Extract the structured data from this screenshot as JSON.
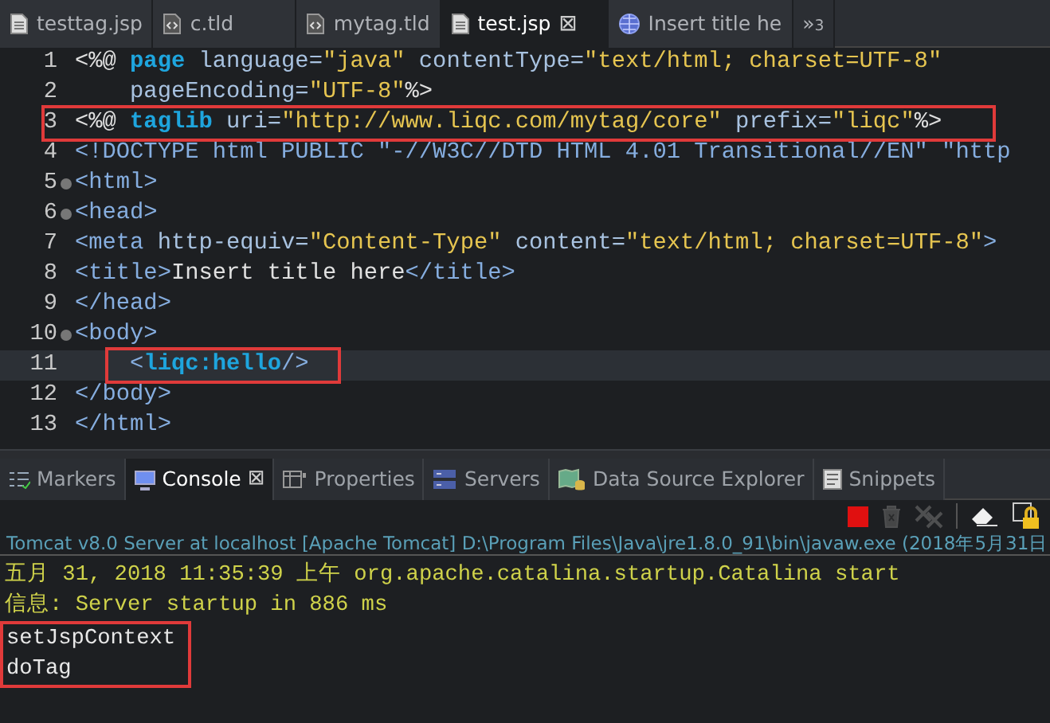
{
  "editor_tabs": [
    {
      "label": "testtag.jsp",
      "kind": "file",
      "selected": false
    },
    {
      "label": "c.tld",
      "kind": "xml",
      "selected": false
    },
    {
      "label": "mytag.tld",
      "kind": "xml",
      "selected": false
    },
    {
      "label": "test.jsp",
      "kind": "file",
      "selected": true,
      "close": "⊠"
    },
    {
      "label": "Insert title he",
      "kind": "globe",
      "selected": false
    }
  ],
  "tabs_overflow": {
    "glyph": "»",
    "count": "3"
  },
  "code_lines": [
    {
      "number": "1",
      "fold": false,
      "current": false,
      "boxed": false,
      "tokens": [
        {
          "kind": "plain",
          "text": "<%@ "
        },
        {
          "kind": "keyword",
          "text": "page"
        },
        {
          "kind": "attr",
          "text": " language="
        },
        {
          "kind": "string",
          "text": "\"java\""
        },
        {
          "kind": "attr",
          "text": " contentType="
        },
        {
          "kind": "string",
          "text": "\"text/html; charset=UTF-8\""
        }
      ]
    },
    {
      "number": "2",
      "fold": false,
      "current": false,
      "boxed": false,
      "tokens": [
        {
          "kind": "attr",
          "text": "    pageEncoding="
        },
        {
          "kind": "string",
          "text": "\"UTF-8\""
        },
        {
          "kind": "plain",
          "text": "%>"
        }
      ]
    },
    {
      "number": "3",
      "fold": false,
      "current": false,
      "boxed": true,
      "tokens": [
        {
          "kind": "plain",
          "text": "<%@ "
        },
        {
          "kind": "keyword",
          "text": "taglib"
        },
        {
          "kind": "attr",
          "text": " uri="
        },
        {
          "kind": "string",
          "text": "\"http://www.liqc.com/mytag/core\""
        },
        {
          "kind": "attr",
          "text": " prefix="
        },
        {
          "kind": "string",
          "text": "\"liqc\""
        },
        {
          "kind": "plain",
          "text": "%>"
        }
      ]
    },
    {
      "number": "4",
      "fold": false,
      "current": false,
      "boxed": false,
      "tokens": [
        {
          "kind": "tag",
          "text": "<!DOCTYPE html PUBLIC \"-//W3C//DTD HTML 4.01 Transitional//EN\" \"http"
        }
      ]
    },
    {
      "number": "5",
      "fold": true,
      "current": false,
      "boxed": false,
      "tokens": [
        {
          "kind": "tag",
          "text": "<html>"
        }
      ]
    },
    {
      "number": "6",
      "fold": true,
      "current": false,
      "boxed": false,
      "tokens": [
        {
          "kind": "tag",
          "text": "<head>"
        }
      ]
    },
    {
      "number": "7",
      "fold": false,
      "current": false,
      "boxed": false,
      "tokens": [
        {
          "kind": "tag",
          "text": "<meta"
        },
        {
          "kind": "attr",
          "text": " http-equiv="
        },
        {
          "kind": "string",
          "text": "\"Content-Type\""
        },
        {
          "kind": "attr",
          "text": " content="
        },
        {
          "kind": "string",
          "text": "\"text/html; charset=UTF-8\""
        },
        {
          "kind": "tag",
          "text": ">"
        }
      ]
    },
    {
      "number": "8",
      "fold": false,
      "current": false,
      "boxed": false,
      "tokens": [
        {
          "kind": "tag",
          "text": "<title>"
        },
        {
          "kind": "plain",
          "text": "Insert title here"
        },
        {
          "kind": "tag",
          "text": "</title>"
        }
      ]
    },
    {
      "number": "9",
      "fold": false,
      "current": false,
      "boxed": false,
      "tokens": [
        {
          "kind": "tag",
          "text": "</head>"
        }
      ]
    },
    {
      "number": "10",
      "fold": true,
      "current": false,
      "boxed": false,
      "tokens": [
        {
          "kind": "tag",
          "text": "<body>"
        }
      ]
    },
    {
      "number": "11",
      "fold": false,
      "current": true,
      "boxed": true,
      "tokens": [
        {
          "kind": "tag",
          "text": "    <"
        },
        {
          "kind": "keyword",
          "text": "liqc:hello"
        },
        {
          "kind": "tag",
          "text": "/>"
        }
      ]
    },
    {
      "number": "12",
      "fold": false,
      "current": false,
      "boxed": false,
      "tokens": [
        {
          "kind": "tag",
          "text": "</body>"
        }
      ]
    },
    {
      "number": "13",
      "fold": false,
      "current": false,
      "boxed": false,
      "tokens": [
        {
          "kind": "tag",
          "text": "</html>"
        }
      ]
    }
  ],
  "view_tabs": [
    {
      "label": "Markers",
      "kind": "markers",
      "selected": false
    },
    {
      "label": "Console",
      "kind": "console",
      "selected": true,
      "close": "⊠"
    },
    {
      "label": "Properties",
      "kind": "properties",
      "selected": false
    },
    {
      "label": "Servers",
      "kind": "servers",
      "selected": false
    },
    {
      "label": "Data Source Explorer",
      "kind": "datasource",
      "selected": false
    },
    {
      "label": "Snippets",
      "kind": "snippets",
      "selected": false
    }
  ],
  "console_toolbar": [
    {
      "kind": "stop",
      "disabled": false
    },
    {
      "kind": "remove",
      "disabled": true
    },
    {
      "kind": "remove-all",
      "disabled": true
    },
    {
      "kind": "clear",
      "disabled": false
    },
    {
      "kind": "lock",
      "disabled": false
    }
  ],
  "console_title": "Tomcat v8.0 Server at localhost [Apache Tomcat] D:\\Program Files\\Java\\jre1.8.0_91\\bin\\javaw.exe (2018年5月31日",
  "console_lines": [
    {
      "kind": "stderr",
      "boxed": false,
      "text": "五月 31, 2018 11:35:39 上午 org.apache.catalina.startup.Catalina start"
    },
    {
      "kind": "stderr",
      "boxed": false,
      "text": "信息: Server startup in 886 ms"
    },
    {
      "kind": "stdout",
      "boxed": true,
      "text": "setJspContext"
    },
    {
      "kind": "stdout",
      "boxed": true,
      "text": "doTag"
    }
  ]
}
